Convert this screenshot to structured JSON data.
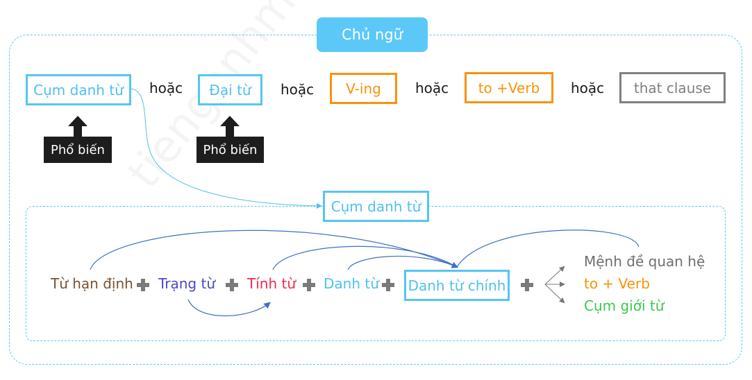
{
  "title": "Chủ ngữ",
  "watermark": "tienganhmoingay.com",
  "subject_options": [
    {
      "label": "Cụm danh từ",
      "style": "blue"
    },
    {
      "label": "Đại từ",
      "style": "blue"
    },
    {
      "label": "V-ing",
      "style": "orange"
    },
    {
      "label": "to +Verb",
      "style": "orange"
    },
    {
      "label": "that clause",
      "style": "gray"
    }
  ],
  "separator": "hoặc",
  "badges": [
    "Phổ biến",
    "Phổ biến"
  ],
  "noun_phrase": {
    "title": "Cụm danh từ",
    "components": [
      {
        "label": "Từ hạn định",
        "color": "#7a5230"
      },
      {
        "label": "Trạng từ",
        "color": "#4b46c8"
      },
      {
        "label": "Tính từ",
        "color": "#ee2a4d"
      },
      {
        "label": "Danh từ",
        "color": "#4fc0f0"
      }
    ],
    "head": "Danh từ chính",
    "post_modifiers": [
      {
        "label": "Mệnh đề quan hệ",
        "color": "#6f6f6f"
      },
      {
        "label": "to + Verb",
        "color": "#f7930a"
      },
      {
        "label": "Cụm giới từ",
        "color": "#3cc84a"
      }
    ]
  },
  "colors": {
    "accent": "#5bc8f7",
    "arrow": "#3d6fc4"
  }
}
